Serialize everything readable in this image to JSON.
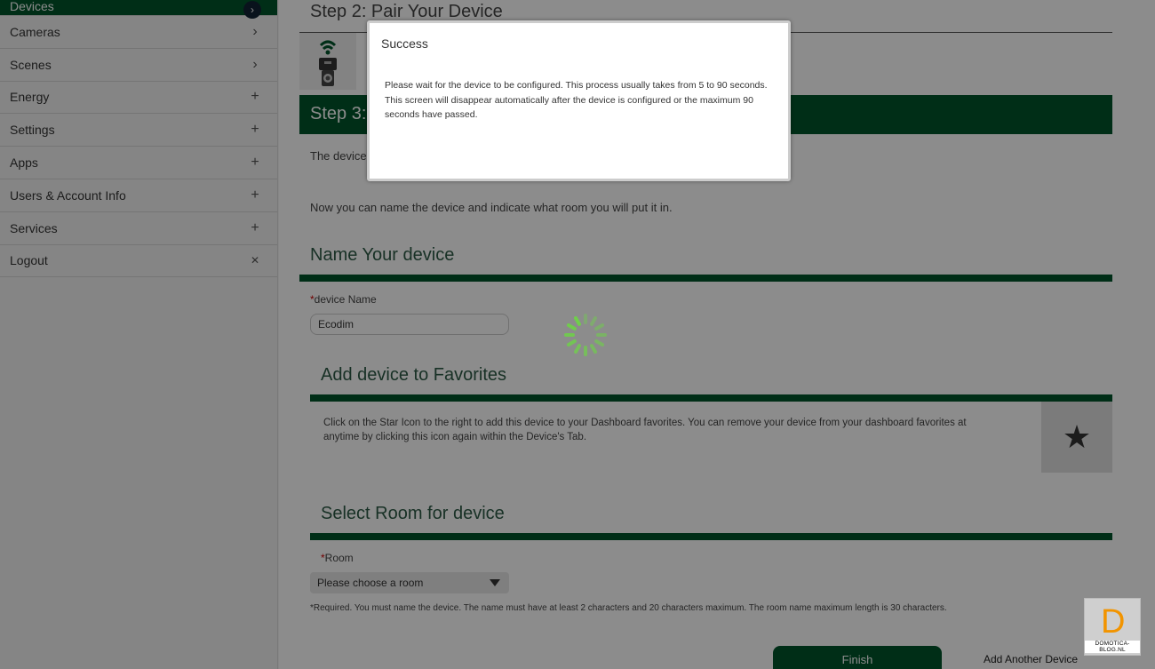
{
  "sidebar": {
    "items": [
      {
        "label": "Devices",
        "icon": "chevron-right",
        "active": true
      },
      {
        "label": "Cameras",
        "icon": "chevron-right"
      },
      {
        "label": "Scenes",
        "icon": "chevron-right"
      },
      {
        "label": "Energy",
        "icon": "plus"
      },
      {
        "label": "Settings",
        "icon": "plus"
      },
      {
        "label": "Apps",
        "icon": "plus"
      },
      {
        "label": "Users & Account Info",
        "icon": "plus"
      },
      {
        "label": "Services",
        "icon": "plus"
      },
      {
        "label": "Logout",
        "icon": "close"
      }
    ],
    "glyphs": {
      "chevron": "›",
      "plus": "+",
      "close": "✕"
    }
  },
  "main": {
    "step2_title": "Step 2: Pair Your Device",
    "step3_title": "Step 3:",
    "device_text": "The device",
    "now_text": "Now you can name the device and indicate what room you will put it in.",
    "name_section": {
      "title": "Name Your device",
      "required_mark": "*",
      "field_label": "device Name",
      "field_value": "Ecodim"
    },
    "favorites_section": {
      "title": "Add device to Favorites",
      "description": "Click on the Star Icon to the right to add this device to your Dashboard favorites. You can remove your device from your dashboard favorites at anytime by clicking this icon again within the Device's Tab.",
      "star": "★"
    },
    "room_section": {
      "title": "Select Room for device",
      "required_mark": "*",
      "field_label": "Room",
      "selected": "Please choose a room"
    },
    "required_note": "*Required. You must name the device. The name must have at least 2 characters and 20 characters maximum. The room name maximum length is 30 characters.",
    "finish_label": "Finish",
    "add_another_label": "Add Another Device"
  },
  "modal": {
    "title": "Success",
    "message": "Please wait for the device to be configured. This process usually takes from 5 to 90 seconds. This screen will disappear automatically after the device is configured or the maximum 90 seconds have passed."
  },
  "watermark": {
    "letter": "D",
    "text": "DOMOTICA-BLOG.NL"
  },
  "colors": {
    "brand_green": "#00552b",
    "spinner_green": "#6fcf4a",
    "watermark_orange": "#f29400"
  }
}
